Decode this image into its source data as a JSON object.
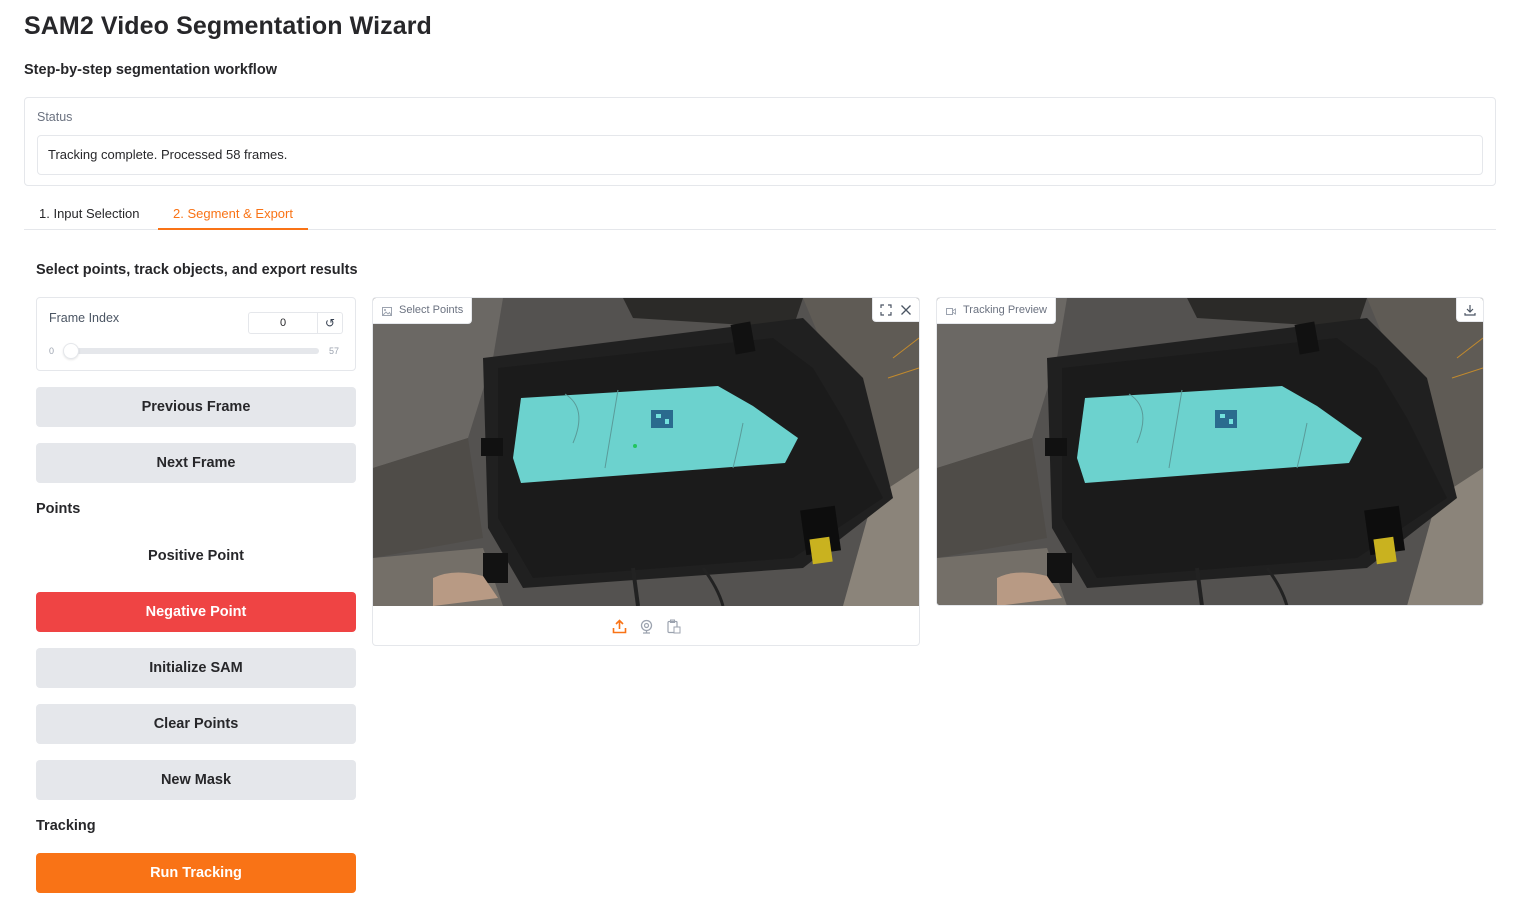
{
  "app": {
    "title": "SAM2 Video Segmentation Wizard",
    "subtitle": "Step-by-step segmentation workflow"
  },
  "status": {
    "label": "Status",
    "value": "Tracking complete. Processed 58 frames."
  },
  "tabs": [
    {
      "label": "1. Input Selection",
      "active": false
    },
    {
      "label": "2. Segment & Export",
      "active": true
    }
  ],
  "section_heading": "Select points, track objects, and export results",
  "frame_index": {
    "label": "Frame Index",
    "value": "0",
    "min": "0",
    "max": "57",
    "reset_icon": "refresh-icon"
  },
  "buttons": {
    "previous_frame": "Previous Frame",
    "next_frame": "Next Frame",
    "positive_point": "Positive Point",
    "negative_point": "Negative Point",
    "initialize_sam": "Initialize SAM",
    "clear_points": "Clear Points",
    "new_mask": "New Mask",
    "run_tracking": "Run Tracking"
  },
  "groups": {
    "points": "Points",
    "tracking": "Tracking"
  },
  "panels": {
    "select_points": {
      "label": "Select Points",
      "icons": [
        "image-icon",
        "fullscreen-icon",
        "close-icon",
        "upload-icon",
        "webcam-icon",
        "clipboard-icon"
      ]
    },
    "tracking_preview": {
      "label": "Tracking Preview",
      "icons": [
        "video-icon",
        "download-icon"
      ]
    }
  },
  "colors": {
    "accent": "#f97316",
    "danger": "#ef4444",
    "button_gray": "#e5e7eb",
    "mask": "#6ee7e0"
  }
}
